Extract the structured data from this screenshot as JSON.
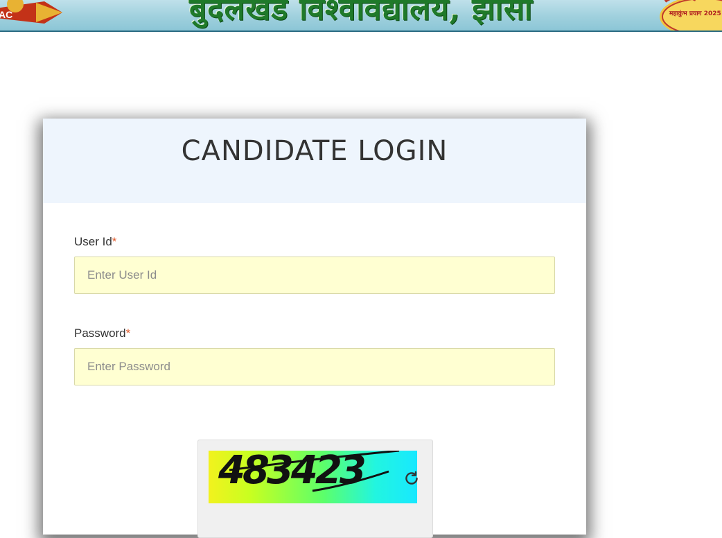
{
  "banner": {
    "title": "बुंदेलखंड विश्वविद्यालय, झाँसी",
    "left_badge_text": "AC",
    "right_badge_text": "महाकुंभ प्रयाग 2025"
  },
  "login": {
    "title": "CANDIDATE LOGIN",
    "user_id": {
      "label": "User Id",
      "required_mark": "*",
      "placeholder": "Enter User Id",
      "value": ""
    },
    "password": {
      "label": "Password",
      "required_mark": "*",
      "placeholder": "Enter Password",
      "value": ""
    },
    "captcha": {
      "code": "483423",
      "refresh_icon": "refresh-icon"
    }
  },
  "colors": {
    "input_bg": "#ffffd2",
    "header_bg": "#eef5fd",
    "required": "#e05a2b",
    "banner_title": "#1f7a2a"
  }
}
